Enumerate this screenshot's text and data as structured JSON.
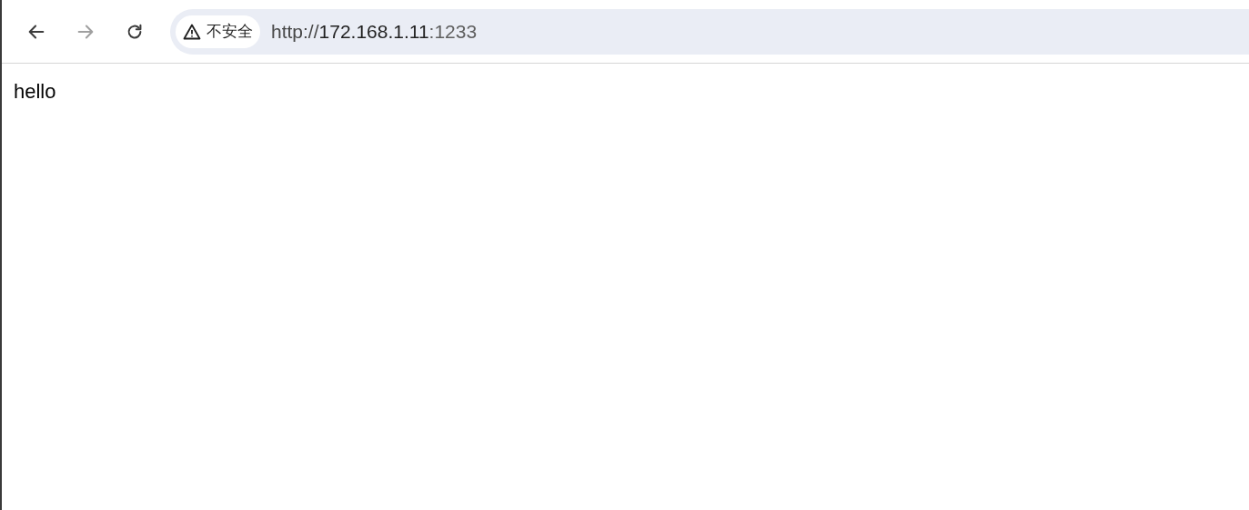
{
  "toolbar": {
    "nav_buttons": [
      {
        "kind": "back",
        "disabled": false
      },
      {
        "kind": "forward",
        "disabled": true
      },
      {
        "kind": "reload",
        "disabled": false
      }
    ],
    "address_bar": {
      "security_label": "不安全",
      "url_scheme": "http://",
      "url_host": "172.168.1.11",
      "url_port": ":1233"
    }
  },
  "page": {
    "text": "hello"
  }
}
